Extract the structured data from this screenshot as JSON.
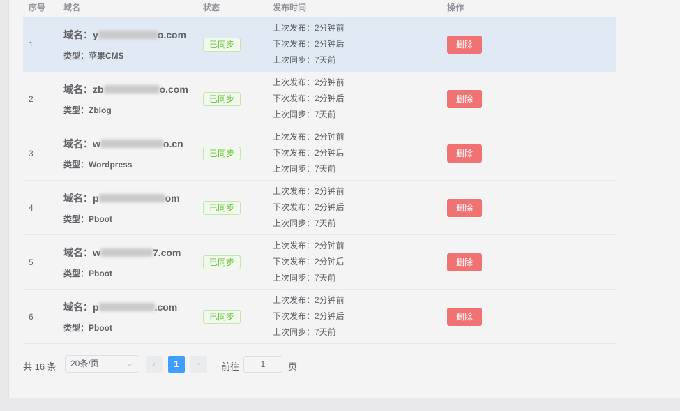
{
  "headers": {
    "index": "序号",
    "domain": "域名",
    "status": "状态",
    "publish_time": "发布时间",
    "actions": "操作"
  },
  "labels": {
    "domain_prefix": "域名：",
    "type_prefix": "类型："
  },
  "rows": [
    {
      "index": "1",
      "domain_head": "y",
      "domain_tail": "o.com",
      "type": "苹果CMS",
      "status": "已同步",
      "last_publish": "上次发布：2分钟前",
      "next_publish": "下次发布：2分钟后",
      "last_sync": "上次同步：7天前",
      "delete_label": "删除"
    },
    {
      "index": "2",
      "domain_head": "zb",
      "domain_tail": "o.com",
      "type": "Zblog",
      "status": "已同步",
      "last_publish": "上次发布：2分钟前",
      "next_publish": "下次发布：2分钟后",
      "last_sync": "上次同步：7天前",
      "delete_label": "删除"
    },
    {
      "index": "3",
      "domain_head": "w",
      "domain_tail": "o.cn",
      "type": "Wordpress",
      "status": "已同步",
      "last_publish": "上次发布：2分钟前",
      "next_publish": "下次发布：2分钟后",
      "last_sync": "上次同步：7天前",
      "delete_label": "删除"
    },
    {
      "index": "4",
      "domain_head": "p",
      "domain_tail": "om",
      "type": "Pboot",
      "status": "已同步",
      "last_publish": "上次发布：2分钟前",
      "next_publish": "下次发布：2分钟后",
      "last_sync": "上次同步：7天前",
      "delete_label": "删除"
    },
    {
      "index": "5",
      "domain_head": "w",
      "domain_tail": "7.com",
      "type": "Pboot",
      "status": "已同步",
      "last_publish": "上次发布：2分钟前",
      "next_publish": "下次发布：2分钟后",
      "last_sync": "上次同步：7天前",
      "delete_label": "删除"
    },
    {
      "index": "6",
      "domain_head": "p",
      "domain_tail": ".com",
      "type": "Pboot",
      "status": "已同步",
      "last_publish": "上次发布：2分钟前",
      "next_publish": "下次发布：2分钟后",
      "last_sync": "上次同步：7天前",
      "delete_label": "删除"
    }
  ],
  "pagination": {
    "total": "共 16 条",
    "page_size": "20条/页",
    "current_page": "1",
    "goto_label": "前往",
    "goto_value": "1",
    "goto_unit": "页",
    "prev_icon": "chevron-left-icon",
    "next_icon": "chevron-right-icon"
  },
  "colors": {
    "synced": "#67c23a",
    "delete": "#f07272",
    "active_page": "#409eff",
    "row_highlight": "#e1e9f5"
  }
}
